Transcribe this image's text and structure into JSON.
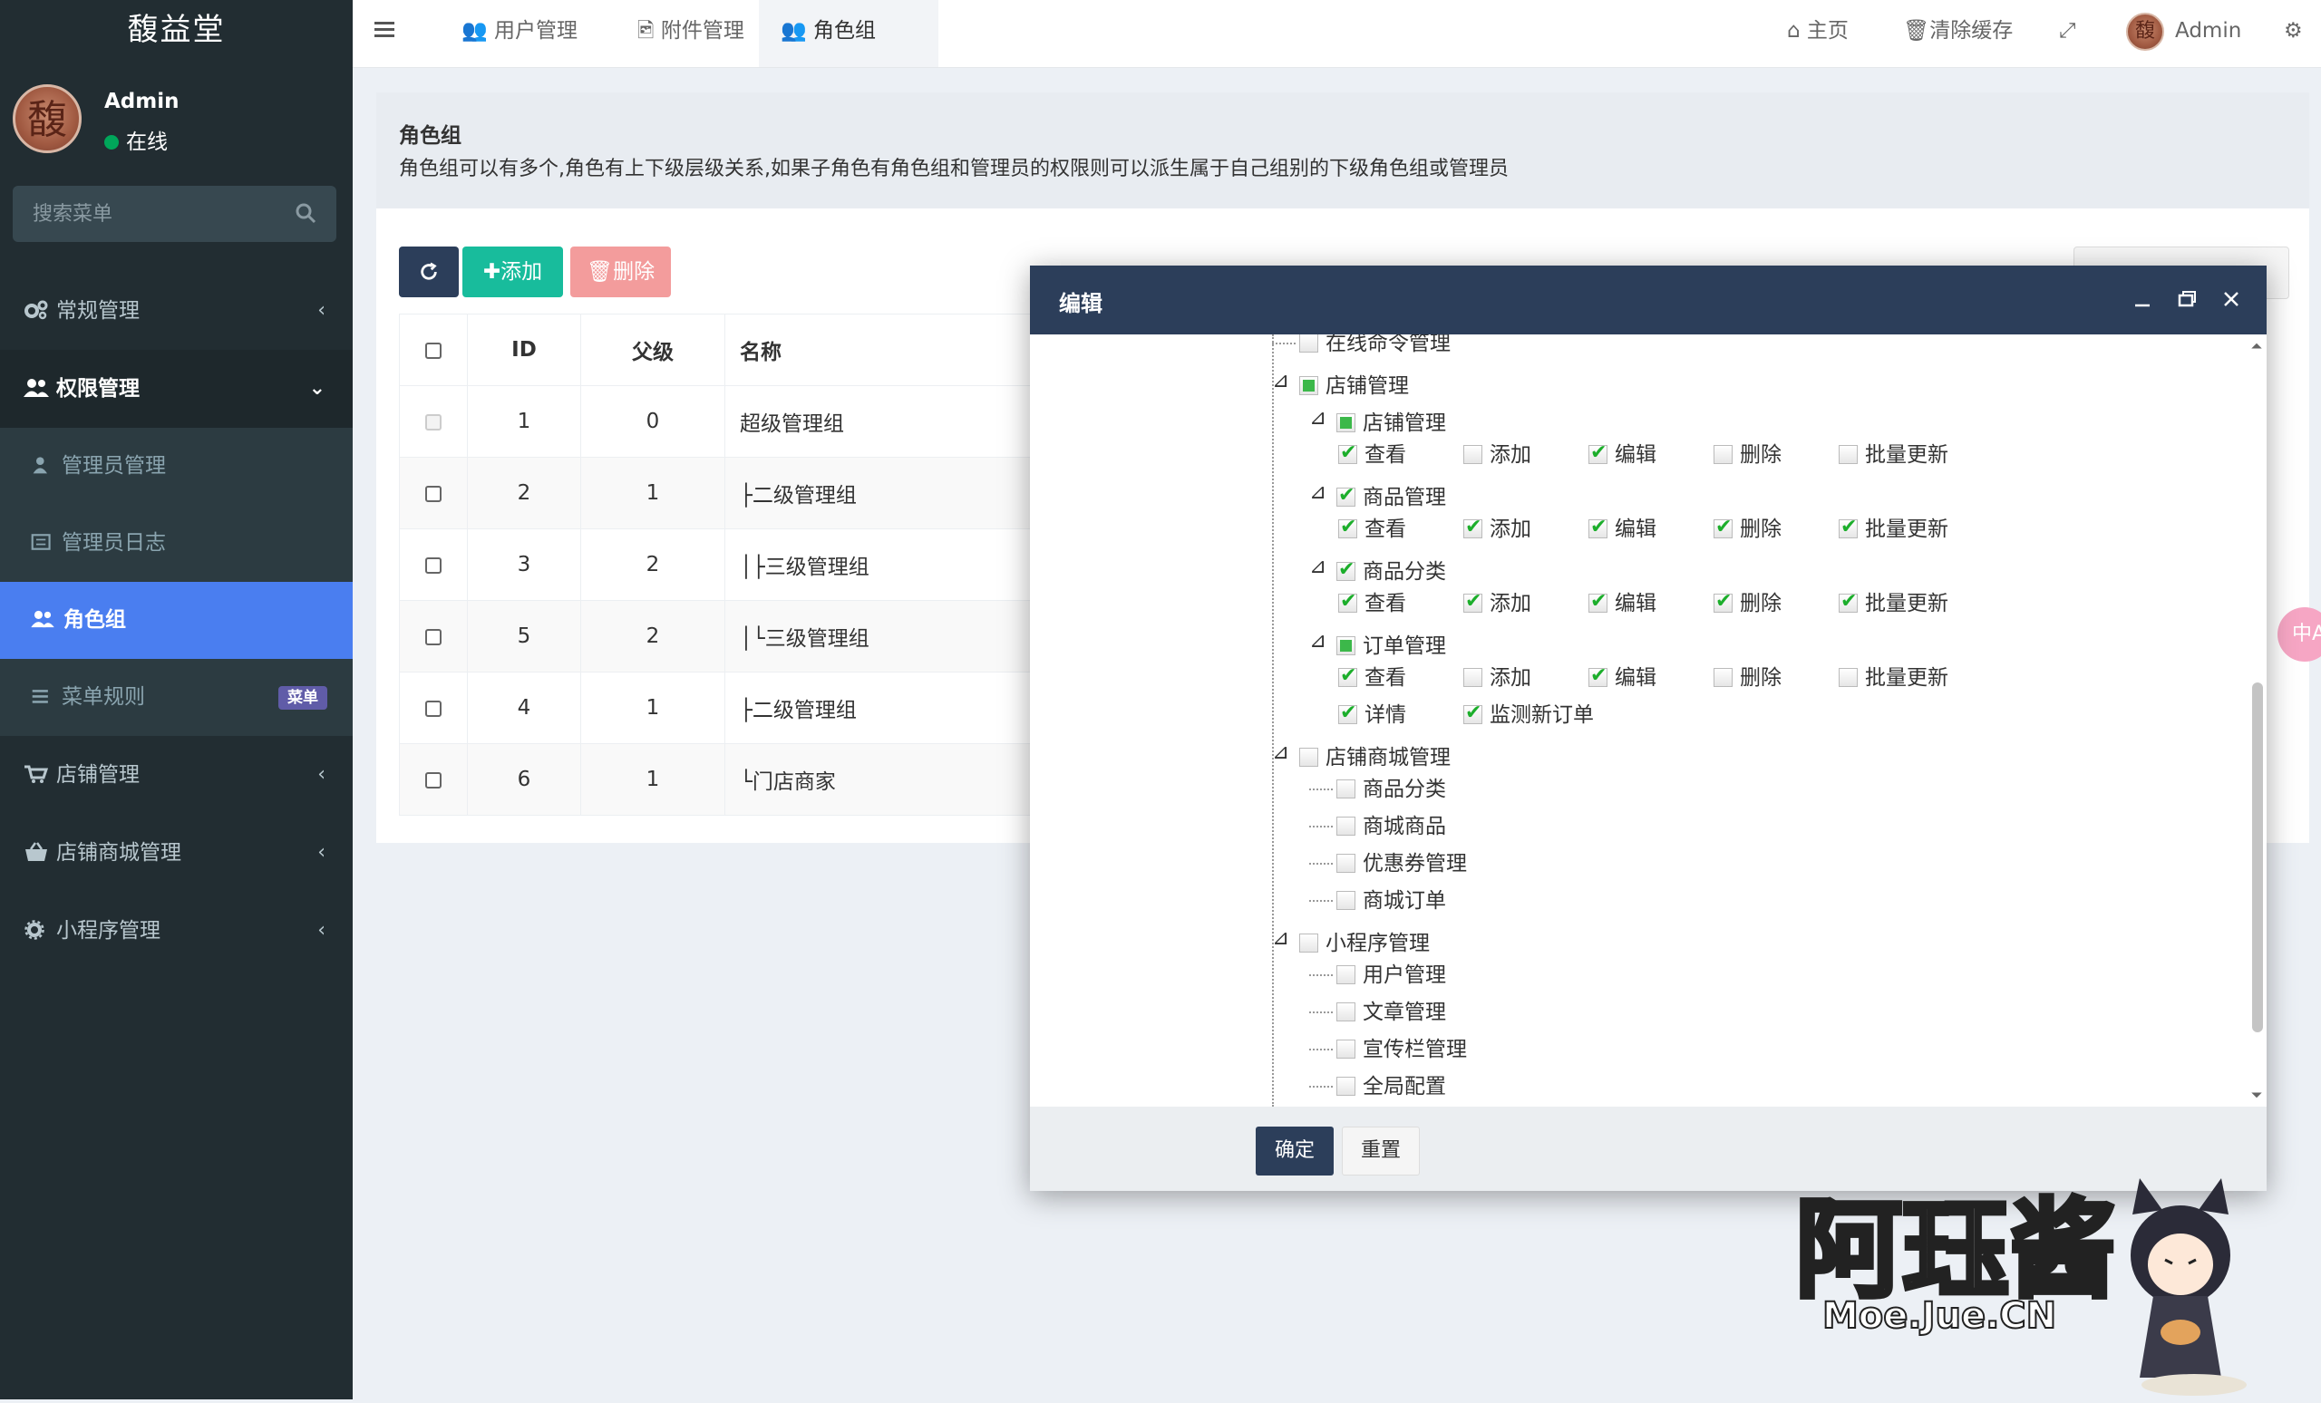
{
  "app": {
    "title": "馥益堂"
  },
  "user": {
    "name": "Admin",
    "status": "在线",
    "avatar_char": "馥"
  },
  "search": {
    "placeholder": "搜索菜单"
  },
  "sidebar": {
    "items": [
      {
        "label": "常规管理",
        "icon": "gears-icon"
      },
      {
        "label": "权限管理",
        "icon": "users-icon"
      },
      {
        "label": "管理员管理",
        "icon": "user-icon"
      },
      {
        "label": "管理员日志",
        "icon": "list-alt-icon"
      },
      {
        "label": "角色组",
        "icon": "group-icon"
      },
      {
        "label": "菜单规则",
        "icon": "bars-icon",
        "badge": "菜单"
      },
      {
        "label": "店铺管理",
        "icon": "cart-icon"
      },
      {
        "label": "店铺商城管理",
        "icon": "basket-icon"
      },
      {
        "label": "小程序管理",
        "icon": "cog-icon"
      }
    ]
  },
  "topbar": {
    "tabs": [
      {
        "label": "用户管理"
      },
      {
        "label": "附件管理"
      },
      {
        "label": "角色组"
      }
    ],
    "home": "主页",
    "clear_cache": "清除缓存",
    "admin": "Admin"
  },
  "panel": {
    "title": "角色组",
    "description": "角色组可以有多个,角色有上下级层级关系,如果子角色有角色组和管理员的权限则可以派生属于自己组别的下级角色组或管理员"
  },
  "toolbar": {
    "add": "添加",
    "delete": "删除"
  },
  "table": {
    "headers": [
      "ID",
      "父级",
      "名称"
    ],
    "rows": [
      {
        "id": "1",
        "pid": "0",
        "name": "超级管理组"
      },
      {
        "id": "2",
        "pid": "1",
        "name": "├二级管理组"
      },
      {
        "id": "3",
        "pid": "2",
        "name": "│├三级管理组"
      },
      {
        "id": "5",
        "pid": "2",
        "name": "│└三级管理组"
      },
      {
        "id": "4",
        "pid": "1",
        "name": "├二级管理组"
      },
      {
        "id": "6",
        "pid": "1",
        "name": "└门店商家"
      }
    ]
  },
  "modal": {
    "title": "编辑",
    "confirm": "确定",
    "reset": "重置",
    "tree": {
      "online_cmd": "在线命令管理",
      "shop": "店铺管理",
      "shop_shop": "店铺管理",
      "goods": "商品管理",
      "category": "商品分类",
      "order": "订单管理",
      "view": "查看",
      "add": "添加",
      "edit": "编辑",
      "del": "删除",
      "multi": "批量更新",
      "detail": "详情",
      "monitor": "监测新订单",
      "mall": "店铺商城管理",
      "mall_category": "商品分类",
      "mall_goods": "商城商品",
      "coupon": "优惠券管理",
      "mall_order": "商城订单",
      "mini": "小程序管理",
      "mini_user": "用户管理",
      "article": "文章管理",
      "banner": "宣传栏管理",
      "config": "全局配置"
    }
  },
  "watermark": {
    "text": "阿珏酱",
    "sub": "Moe.Jue.CN"
  },
  "float_label": "中A",
  "colors": {
    "sidebar": "#222d32",
    "active": "#4a7ef0",
    "primary": "#2c3e5a",
    "success": "#18bc9c",
    "danger": "#f39c9c"
  }
}
